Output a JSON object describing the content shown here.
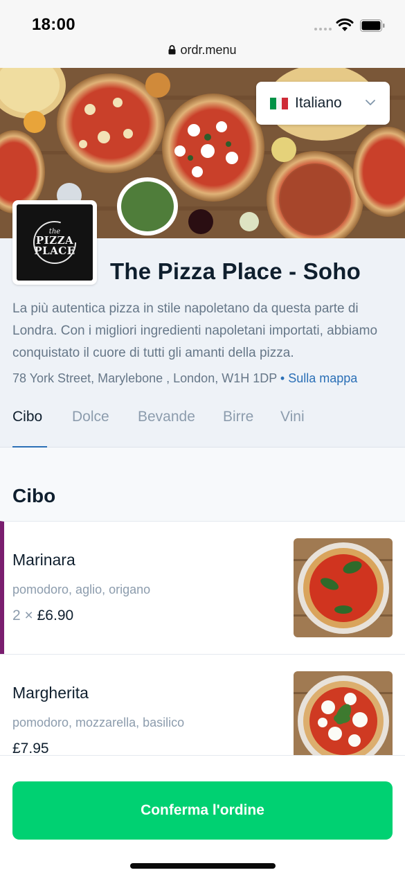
{
  "status": {
    "time": "18:00"
  },
  "browser": {
    "url": "ordr.menu"
  },
  "language": {
    "label": "Italiano",
    "flag_colors": [
      "#009246",
      "#ffffff",
      "#ce2b37"
    ]
  },
  "restaurant": {
    "name": "The Pizza Place - Soho",
    "logo_text_top": "the",
    "logo_text_main": "PIZZA PLACE",
    "description": "La più autentica pizza in stile napoletano da questa parte di Londra. Con i migliori ingredienti napoletani importati, abbiamo conquistato il cuore di tutti gli amanti della pizza.",
    "address": "78 York Street, Marylebone , London, W1H 1DP",
    "map_link": "• Sulla mappa"
  },
  "tabs": [
    {
      "label": "Cibo",
      "active": true
    },
    {
      "label": "Dolce"
    },
    {
      "label": "Bevande"
    },
    {
      "label": "Birre"
    },
    {
      "label": "Vini"
    }
  ],
  "section": {
    "title": "Cibo"
  },
  "items": [
    {
      "name": "Marinara",
      "ingredients": "pomodoro, aglio, origano",
      "quantity": "2 ×",
      "price": "£6.90"
    },
    {
      "name": "Margherita",
      "ingredients": "pomodoro, mozzarella, basilico",
      "quantity": "",
      "price": "£7.95"
    }
  ],
  "actions": {
    "confirm": "Conferma l'ordine"
  },
  "colors": {
    "accent": "#00d172",
    "link": "#2a6fb6",
    "selected_marker": "#7a1e6f"
  }
}
